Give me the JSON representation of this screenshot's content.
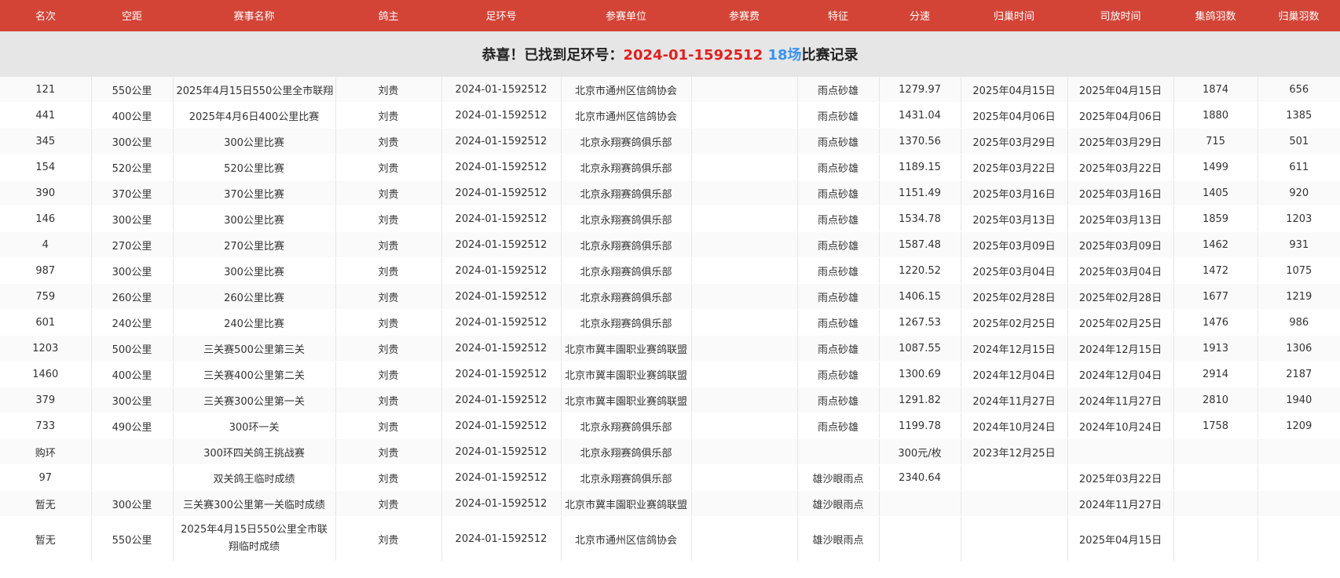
{
  "columns": [
    "名次",
    "空距",
    "赛事名称",
    "鸽主",
    "足环号",
    "参赛单位",
    "参赛费",
    "特征",
    "分速",
    "归巢时间",
    "司放时间",
    "集鸽羽数",
    "归巢羽数"
  ],
  "banner": {
    "prefix": "恭喜！已找到足环号：",
    "ring": "2024-01-1592512",
    "count": "18场",
    "suffix": "比赛记录"
  },
  "rows": [
    [
      "121",
      "550公里",
      "2025年4月15日550公里全市联翔",
      "刘贵",
      "2024-01-1592512",
      "北京市通州区信鸽协会",
      "",
      "雨点砂雄",
      "1279.97",
      "2025年04月15日",
      "2025年04月15日",
      "1874",
      "656"
    ],
    [
      "441",
      "400公里",
      "2025年4月6日400公里比赛",
      "刘贵",
      "2024-01-1592512",
      "北京市通州区信鸽协会",
      "",
      "雨点砂雄",
      "1431.04",
      "2025年04月06日",
      "2025年04月06日",
      "1880",
      "1385"
    ],
    [
      "345",
      "300公里",
      "300公里比赛",
      "刘贵",
      "2024-01-1592512",
      "北京永翔赛鸽俱乐部",
      "",
      "雨点砂雄",
      "1370.56",
      "2025年03月29日",
      "2025年03月29日",
      "715",
      "501"
    ],
    [
      "154",
      "520公里",
      "520公里比赛",
      "刘贵",
      "2024-01-1592512",
      "北京永翔赛鸽俱乐部",
      "",
      "雨点砂雄",
      "1189.15",
      "2025年03月22日",
      "2025年03月22日",
      "1499",
      "611"
    ],
    [
      "390",
      "370公里",
      "370公里比赛",
      "刘贵",
      "2024-01-1592512",
      "北京永翔赛鸽俱乐部",
      "",
      "雨点砂雄",
      "1151.49",
      "2025年03月16日",
      "2025年03月16日",
      "1405",
      "920"
    ],
    [
      "146",
      "300公里",
      "300公里比赛",
      "刘贵",
      "2024-01-1592512",
      "北京永翔赛鸽俱乐部",
      "",
      "雨点砂雄",
      "1534.78",
      "2025年03月13日",
      "2025年03月13日",
      "1859",
      "1203"
    ],
    [
      "4",
      "270公里",
      "270公里比赛",
      "刘贵",
      "2024-01-1592512",
      "北京永翔赛鸽俱乐部",
      "",
      "雨点砂雄",
      "1587.48",
      "2025年03月09日",
      "2025年03月09日",
      "1462",
      "931"
    ],
    [
      "987",
      "300公里",
      "300公里比赛",
      "刘贵",
      "2024-01-1592512",
      "北京永翔赛鸽俱乐部",
      "",
      "雨点砂雄",
      "1220.52",
      "2025年03月04日",
      "2025年03月04日",
      "1472",
      "1075"
    ],
    [
      "759",
      "260公里",
      "260公里比赛",
      "刘贵",
      "2024-01-1592512",
      "北京永翔赛鸽俱乐部",
      "",
      "雨点砂雄",
      "1406.15",
      "2025年02月28日",
      "2025年02月28日",
      "1677",
      "1219"
    ],
    [
      "601",
      "240公里",
      "240公里比赛",
      "刘贵",
      "2024-01-1592512",
      "北京永翔赛鸽俱乐部",
      "",
      "雨点砂雄",
      "1267.53",
      "2025年02月25日",
      "2025年02月25日",
      "1476",
      "986"
    ],
    [
      "1203",
      "500公里",
      "三关赛500公里第三关",
      "刘贵",
      "2024-01-1592512",
      "北京市冀丰園职业赛鸽联盟",
      "",
      "雨点砂雄",
      "1087.55",
      "2024年12月15日",
      "2024年12月15日",
      "1913",
      "1306"
    ],
    [
      "1460",
      "400公里",
      "三关赛400公里第二关",
      "刘贵",
      "2024-01-1592512",
      "北京市冀丰園职业赛鸽联盟",
      "",
      "雨点砂雄",
      "1300.69",
      "2024年12月04日",
      "2024年12月04日",
      "2914",
      "2187"
    ],
    [
      "379",
      "300公里",
      "三关赛300公里第一关",
      "刘贵",
      "2024-01-1592512",
      "北京市冀丰園职业赛鸽联盟",
      "",
      "雨点砂雄",
      "1291.82",
      "2024年11月27日",
      "2024年11月27日",
      "2810",
      "1940"
    ],
    [
      "733",
      "490公里",
      "300环一关",
      "刘贵",
      "2024-01-1592512",
      "北京永翔赛鸽俱乐部",
      "",
      "雨点砂雄",
      "1199.78",
      "2024年10月24日",
      "2024年10月24日",
      "1758",
      "1209"
    ],
    [
      "购环",
      "",
      "300环四关鸽王挑战赛",
      "刘贵",
      "2024-01-1592512",
      "北京永翔赛鸽俱乐部",
      "",
      "",
      "300元/枚",
      "2023年12月25日",
      "",
      "",
      ""
    ],
    [
      "97",
      "",
      "双关鸽王临时成绩",
      "刘贵",
      "2024-01-1592512",
      "北京永翔赛鸽俱乐部",
      "",
      "雄沙眼雨点",
      "2340.64",
      "",
      "2025年03月22日",
      "",
      ""
    ],
    [
      "暂无",
      "300公里",
      "三关赛300公里第一关临时成绩",
      "刘贵",
      "2024-01-1592512",
      "北京市冀丰園职业赛鸽联盟",
      "",
      "雄沙眼雨点",
      "",
      "",
      "2024年11月27日",
      "",
      ""
    ],
    [
      "暂无",
      "550公里",
      "2025年4月15日550公里全市联翔临时成绩",
      "刘贵",
      "2024-01-1592512",
      "北京市通州区信鸽协会",
      "",
      "雄沙眼雨点",
      "",
      "",
      "2025年04月15日",
      "",
      ""
    ]
  ]
}
